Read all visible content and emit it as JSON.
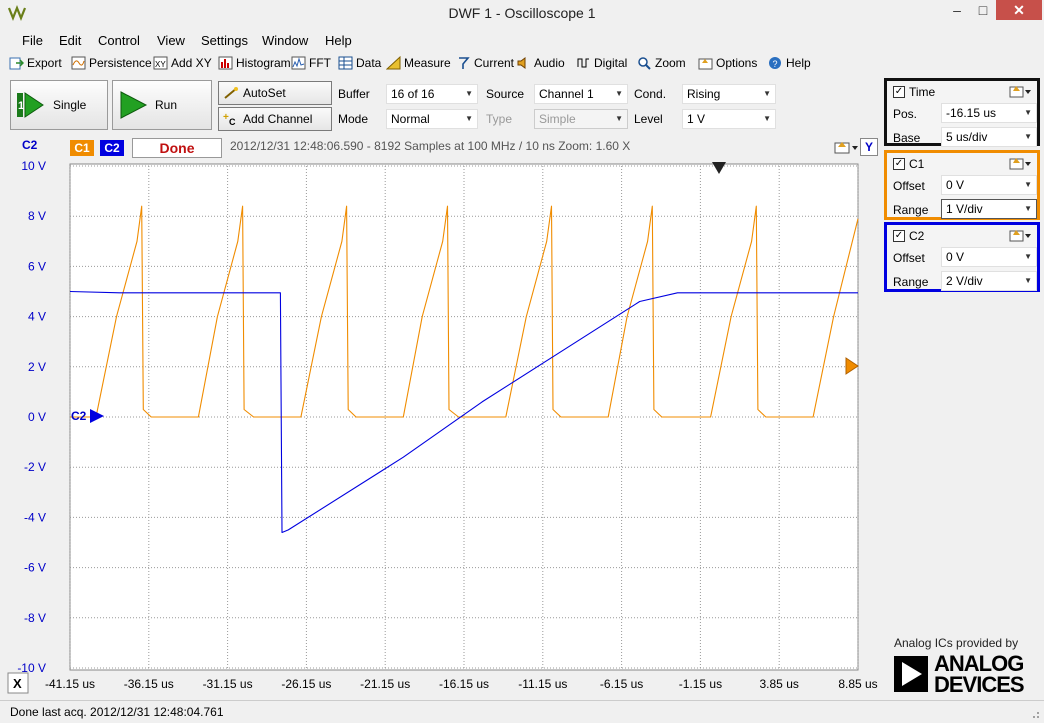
{
  "window": {
    "title": "DWF 1 - Oscilloscope 1",
    "min_label": "–",
    "max_label": "□",
    "close_label": "✕"
  },
  "menu": [
    "File",
    "Edit",
    "Control",
    "View",
    "Settings",
    "Window",
    "Help"
  ],
  "toolbar": [
    {
      "label": "Export",
      "icon": "export-icon"
    },
    {
      "label": "Persistence",
      "icon": "persistence-icon"
    },
    {
      "label": "Add XY",
      "icon": "add-xy-icon"
    },
    {
      "label": "Histogram",
      "icon": "histogram-icon"
    },
    {
      "label": "FFT",
      "icon": "fft-icon"
    },
    {
      "label": "Data",
      "icon": "data-icon"
    },
    {
      "label": "Measure",
      "icon": "measure-icon"
    },
    {
      "label": "Current",
      "icon": "current-icon"
    },
    {
      "label": "Audio",
      "icon": "audio-icon"
    },
    {
      "label": "Digital",
      "icon": "digital-icon"
    },
    {
      "label": "Zoom",
      "icon": "zoom-icon"
    },
    {
      "label": "Options",
      "icon": "options-icon"
    },
    {
      "label": "Help",
      "icon": "help-icon"
    }
  ],
  "controls": {
    "single_label": "Single",
    "run_label": "Run",
    "autoset_label": "AutoSet",
    "add_channel_label": "Add Channel",
    "buffer_label": "Buffer",
    "buffer_value": "16 of 16",
    "mode_label": "Mode",
    "mode_value": "Normal",
    "source_label": "Source",
    "source_value": "Channel 1",
    "type_label": "Type",
    "type_value": "Simple",
    "cond_label": "Cond.",
    "cond_value": "Rising",
    "level_label": "Level",
    "level_value": "1 V"
  },
  "plotbar": {
    "c1": "C1",
    "c2": "C2",
    "status": "Done",
    "info": "2012/12/31  12:48:06.590 - 8192 Samples at 100 MHz / 10 ns Zoom: 1.60 X",
    "y_btn": "Y",
    "corner": "C2",
    "x_btn": "X"
  },
  "time_panel": {
    "title": "Time",
    "pos_label": "Pos.",
    "pos_value": "-16.15 us",
    "base_label": "Base",
    "base_value": "5 us/div"
  },
  "c1_panel": {
    "title": "C1",
    "offset_label": "Offset",
    "offset_value": "0 V",
    "range_label": "Range",
    "range_value": "1 V/div"
  },
  "c2_panel": {
    "title": "C2",
    "offset_label": "Offset",
    "offset_value": "0 V",
    "range_label": "Range",
    "range_value": "2 V/div"
  },
  "status_bar": "Done last acq. 2012/12/31  12:48:04.761",
  "branding": {
    "tagline": "Analog ICs provided by",
    "name_line1": "ANALOG",
    "name_line2": "DEVICES"
  },
  "colors": {
    "c1": "#f08c00",
    "c2": "#0000e0",
    "grid": "#999999",
    "axis_text": "#0000c8"
  },
  "chart_data": {
    "type": "line",
    "x_tick_labels": [
      "-41.15 us",
      "-36.15 us",
      "-31.15 us",
      "-26.15 us",
      "-21.15 us",
      "-16.15 us",
      "-11.15 us",
      "-6.15 us",
      "-1.15 us",
      "3.85 us",
      "8.85 us"
    ],
    "y_tick_labels": [
      "10 V",
      "8 V",
      "6 V",
      "4 V",
      "2 V",
      "0 V",
      "-2 V",
      "-4 V",
      "-6 V",
      "-8 V",
      "-10 V"
    ],
    "xlim": [
      -41.15,
      8.85
    ],
    "ylim": [
      -10,
      10
    ],
    "x_unit": "us",
    "grid": true,
    "series": [
      {
        "name": "C1",
        "color": "#f08c00",
        "points": [
          [
            -41.15,
            0
          ],
          [
            -39.5,
            0
          ],
          [
            -38.2,
            4
          ],
          [
            -36.9,
            7
          ],
          [
            -36.6,
            8.4
          ],
          [
            -36.5,
            0.3
          ],
          [
            -36,
            0
          ],
          [
            -33,
            0
          ],
          [
            -31.8,
            4
          ],
          [
            -30.5,
            7
          ],
          [
            -30.2,
            8.4
          ],
          [
            -30.1,
            0.3
          ],
          [
            -29.5,
            0
          ],
          [
            -26.5,
            0
          ],
          [
            -25.2,
            4
          ],
          [
            -23.9,
            7
          ],
          [
            -23.6,
            8.4
          ],
          [
            -23.5,
            0.3
          ],
          [
            -23,
            0
          ],
          [
            -20,
            0
          ],
          [
            -18.8,
            4
          ],
          [
            -17.5,
            7
          ],
          [
            -17.2,
            8.4
          ],
          [
            -17.1,
            0.3
          ],
          [
            -16.5,
            0
          ],
          [
            -13.5,
            0
          ],
          [
            -12.2,
            4
          ],
          [
            -10.9,
            7
          ],
          [
            -10.6,
            8.4
          ],
          [
            -10.5,
            0.3
          ],
          [
            -10,
            0
          ],
          [
            -7,
            0
          ],
          [
            -5.8,
            4
          ],
          [
            -4.5,
            7
          ],
          [
            -4.2,
            8.4
          ],
          [
            -4.1,
            0.3
          ],
          [
            -3.6,
            0
          ],
          [
            -0.5,
            0
          ],
          [
            0.8,
            4
          ],
          [
            2.1,
            7
          ],
          [
            2.4,
            8.4
          ],
          [
            2.5,
            0.3
          ],
          [
            3,
            0
          ],
          [
            6,
            0
          ],
          [
            7.3,
            4
          ],
          [
            8.85,
            7.9
          ]
        ]
      },
      {
        "name": "C2",
        "color": "#0000e0",
        "points": [
          [
            -41.15,
            5
          ],
          [
            -38,
            4.95
          ],
          [
            -34,
            4.95
          ],
          [
            -30,
            4.95
          ],
          [
            -27.8,
            4.95
          ],
          [
            -27.7,
            -4.6
          ],
          [
            -27.3,
            -4.5
          ],
          [
            -20,
            -1.6
          ],
          [
            -15,
            0.6
          ],
          [
            -10,
            2.6
          ],
          [
            -5,
            4.6
          ],
          [
            -2.6,
            4.95
          ],
          [
            0,
            4.95
          ],
          [
            4,
            4.95
          ],
          [
            8.85,
            4.95
          ]
        ]
      }
    ]
  }
}
